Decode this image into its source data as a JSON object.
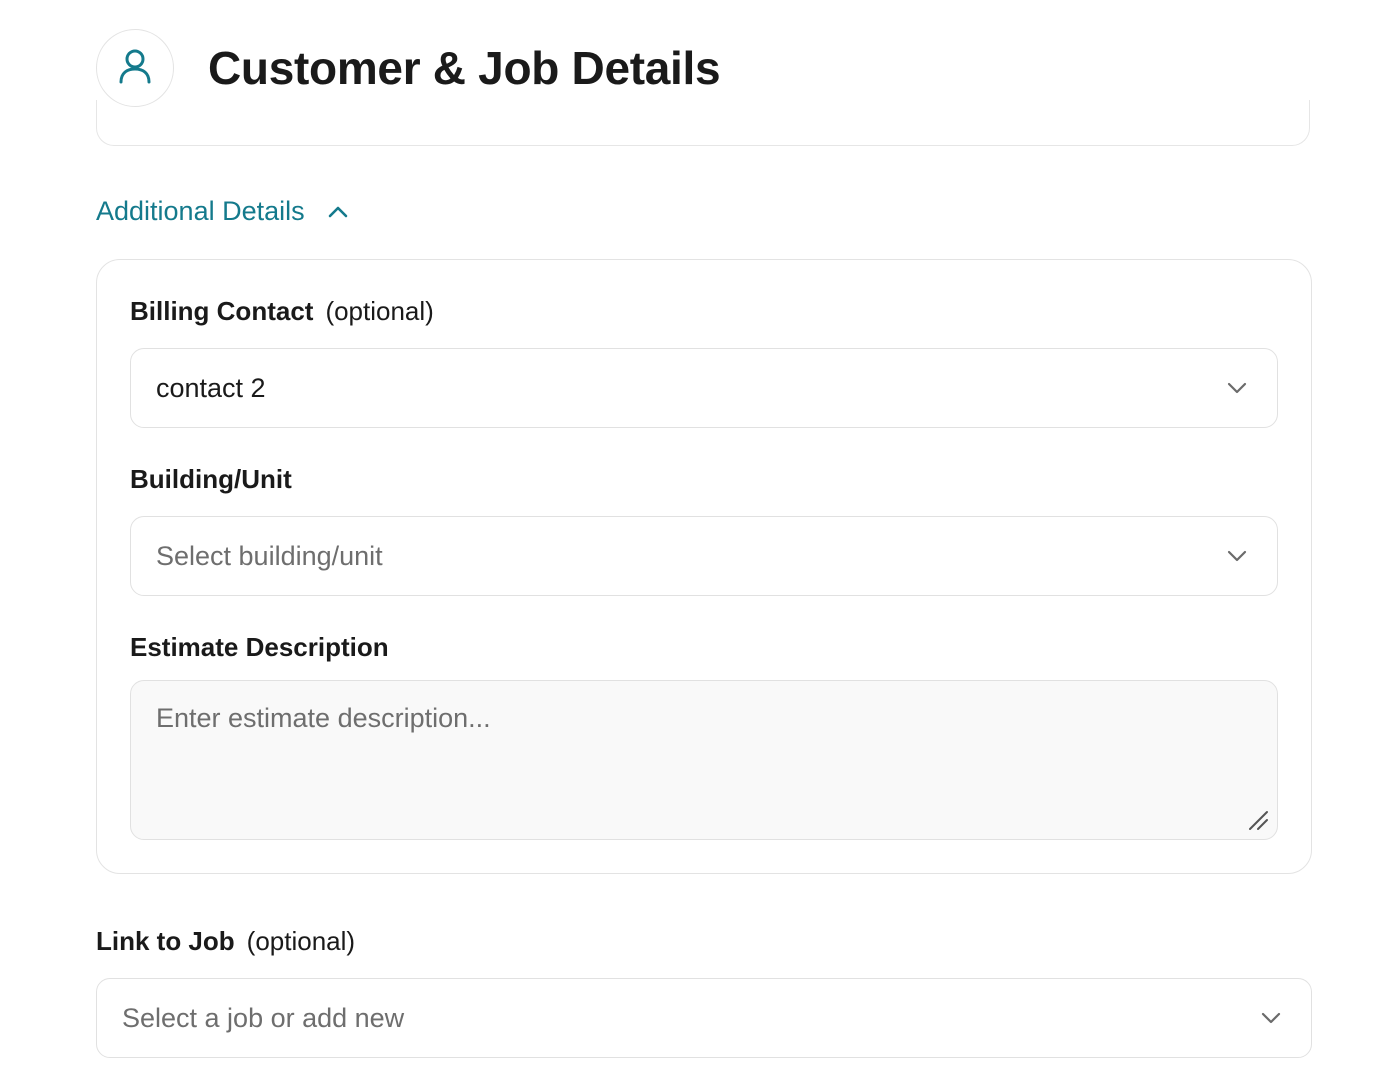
{
  "header": {
    "title": "Customer & Job Details",
    "icon": "user-icon"
  },
  "section": {
    "label": "Additional Details",
    "expanded": true
  },
  "billing_contact": {
    "label": "Billing Contact",
    "optional": "(optional)",
    "value": "contact 2"
  },
  "building_unit": {
    "label": "Building/Unit",
    "placeholder": "Select building/unit"
  },
  "estimate_description": {
    "label": "Estimate Description",
    "placeholder": "Enter estimate description..."
  },
  "link_to_job": {
    "label": "Link to Job",
    "optional": "(optional)",
    "placeholder": "Select a job or add new"
  },
  "colors": {
    "accent": "#147a8c",
    "border": "#e1e1e1"
  }
}
